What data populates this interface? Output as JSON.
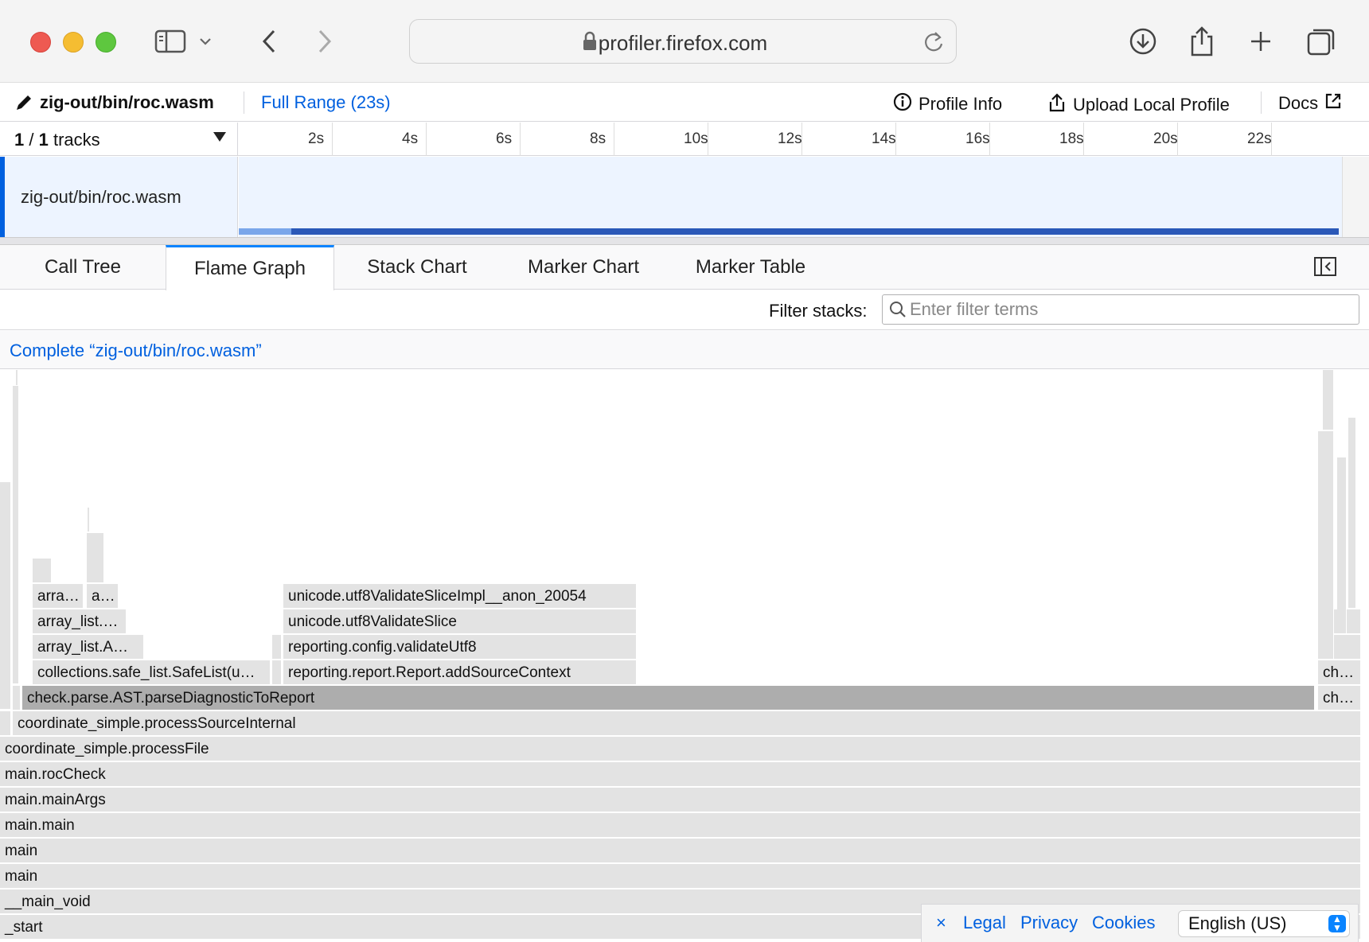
{
  "browser": {
    "url": "profiler.firefox.com"
  },
  "appbar": {
    "profile_name": "zig-out/bin/roc.wasm",
    "range": "Full Range (23s)",
    "profile_info": "Profile Info",
    "upload": "Upload Local Profile",
    "docs": "Docs"
  },
  "timeline": {
    "tracks_current": "1",
    "tracks_sep": " / ",
    "tracks_total": "1",
    "tracks_word": "tracks",
    "ticks": [
      "2s",
      "4s",
      "6s",
      "8s",
      "10s",
      "12s",
      "14s",
      "16s",
      "18s",
      "20s",
      "22s"
    ],
    "track_name": "zig-out/bin/roc.wasm"
  },
  "tabs": [
    "Call Tree",
    "Flame Graph",
    "Stack Chart",
    "Marker Chart",
    "Marker Table"
  ],
  "active_tab": "Flame Graph",
  "filter": {
    "label": "Filter stacks:",
    "placeholder": "Enter filter terms"
  },
  "breadcrumb": "Complete “zig-out/bin/roc.wasm”",
  "flame": {
    "frames": [
      "_start",
      "__main_void",
      "main",
      "main",
      "main.main",
      "main.mainArgs",
      "main.rocCheck",
      "coordinate_simple.processFile",
      "coordinate_simple.processSourceInternal",
      "check.parse.AST.parseDiagnosticToReport",
      "che…",
      "collections.safe_list.SafeList(u…",
      "reporting.report.Report.addSourceContext",
      "che…",
      "array_list.A…",
      "reporting.config.validateUtf8",
      "array_list.…",
      "unicode.utf8ValidateSlice",
      "arra…",
      "a…",
      "unicode.utf8ValidateSliceImpl__anon_20054"
    ]
  },
  "footer": {
    "close": "×",
    "legal": "Legal",
    "privacy": "Privacy",
    "cookies": "Cookies",
    "language": "English (US)"
  }
}
